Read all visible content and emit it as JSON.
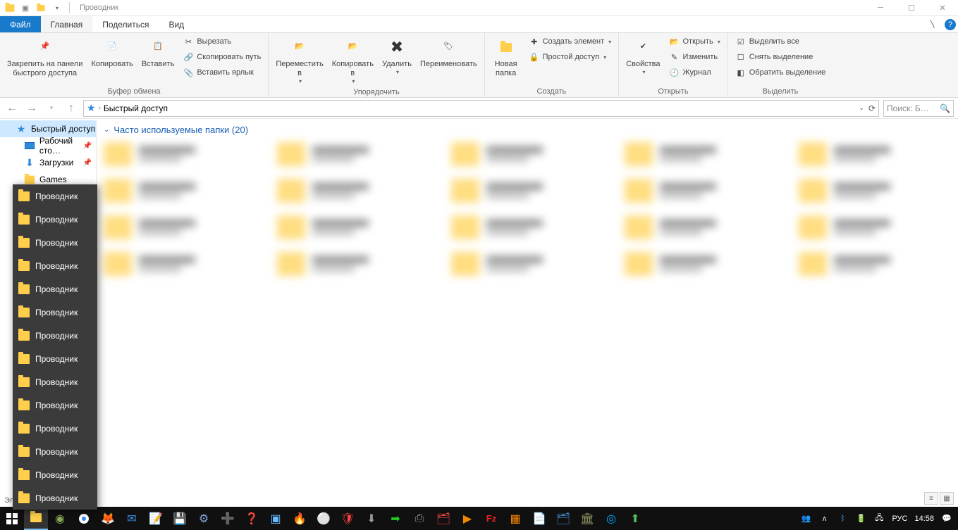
{
  "window": {
    "title": "Проводник"
  },
  "tabs": {
    "file": "Файл",
    "home": "Главная",
    "share": "Поделиться",
    "view": "Вид"
  },
  "ribbon": {
    "clipboard": {
      "pin": "Закрепить на панели\nбыстрого доступа",
      "copy": "Копировать",
      "paste": "Вставить",
      "cut": "Вырезать",
      "copypath": "Скопировать путь",
      "pasteshortcut": "Вставить ярлык",
      "label": "Буфер обмена"
    },
    "organize": {
      "moveto": "Переместить\nв",
      "copyto": "Копировать\nв",
      "delete": "Удалить",
      "rename": "Переименовать",
      "label": "Упорядочить"
    },
    "new": {
      "newfolder": "Новая\nпапка",
      "newitem": "Создать элемент",
      "easyaccess": "Простой доступ",
      "label": "Создать"
    },
    "open": {
      "properties": "Свойства",
      "open": "Открыть",
      "edit": "Изменить",
      "history": "Журнал",
      "label": "Открыть"
    },
    "select": {
      "selectall": "Выделить все",
      "selectnone": "Снять выделение",
      "invert": "Обратить выделение",
      "label": "Выделить"
    }
  },
  "address": {
    "crumb": "Быстрый доступ"
  },
  "search": {
    "placeholder": "Поиск: Б…"
  },
  "sidebar": {
    "items": [
      {
        "label": "Быстрый доступ",
        "icon": "star"
      },
      {
        "label": "Рабочий сто…",
        "icon": "monitor",
        "pinned": true
      },
      {
        "label": "Загрузки",
        "icon": "download",
        "pinned": true
      },
      {
        "label": "Games",
        "icon": "folder"
      }
    ]
  },
  "content": {
    "group_header": "Часто используемые папки (20)",
    "folder_count": 20
  },
  "jumplist": {
    "item_label": "Проводник",
    "count": 14
  },
  "statusbar": {
    "text_prefix": "Эл"
  },
  "taskbar": {
    "lang": "РУС",
    "time": "14:58"
  }
}
